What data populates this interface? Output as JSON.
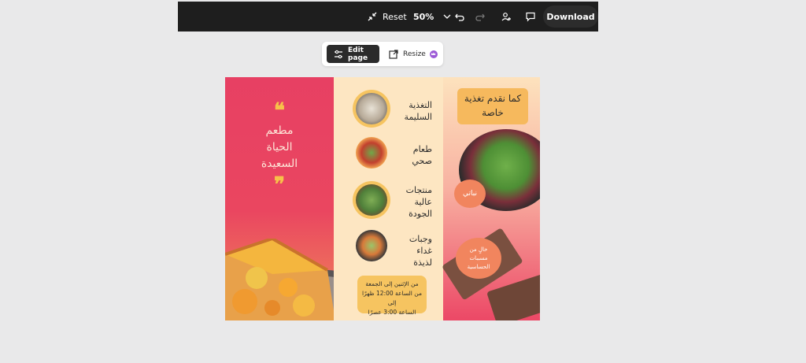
{
  "toolbar": {
    "reset_label": "Reset",
    "zoom_value": "50%",
    "download_label": "Download"
  },
  "floating_toolbar": {
    "edit_page_label": "Edit page",
    "resize_label": "Resize"
  },
  "design": {
    "restaurant_name_line1": "مطعم",
    "restaurant_name_line2": "الحياة",
    "restaurant_name_line3": "السعيدة",
    "quote_open": "❝",
    "quote_close": "❞",
    "items": [
      {
        "line1": "التغذية",
        "line2": "السليمة",
        "line3": ""
      },
      {
        "line1": "طعام",
        "line2": "صحي",
        "line3": ""
      },
      {
        "line1": "منتجات",
        "line2": "عالية",
        "line3": "الجودة"
      },
      {
        "line1": "وجبات",
        "line2": "غداء",
        "line3": "لذيذة"
      }
    ],
    "hours_line1": "من الإثنين إلى الجمعة",
    "hours_line2": "من الساعة 12:00 ظهرًا إلى",
    "hours_line3": "الساعة 3:00 عصرًا",
    "offer_line1": "كما نقدم تغذية",
    "offer_line2": "خاصة",
    "vegan_label": "نباتي",
    "allergen_line1": "خالٍ من",
    "allergen_line2": "مسببات",
    "allergen_line3": "الحساسية"
  },
  "colors": {
    "toolbar_bg": "#1e1e1e",
    "left_panel": "#e74063",
    "mid_panel": "#fde6c2",
    "accent_yellow": "#f6c460",
    "accent_orange": "#f1855e"
  }
}
